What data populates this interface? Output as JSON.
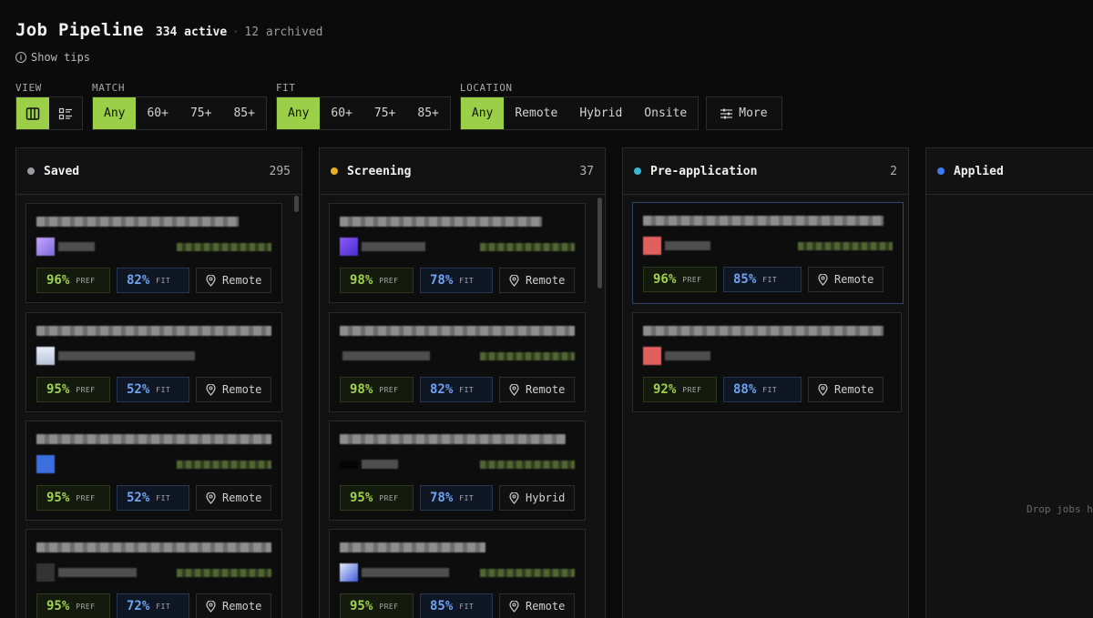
{
  "header": {
    "title": "Job Pipeline",
    "active": "334 active",
    "archived": "12 archived",
    "tips": "Show tips"
  },
  "filters": {
    "view": {
      "label": "VIEW",
      "icons": [
        "board-view-icon",
        "list-view-icon"
      ],
      "selected": "board"
    },
    "match": {
      "label": "MATCH",
      "options": [
        "Any",
        "60+",
        "75+",
        "85+"
      ],
      "selected": "Any"
    },
    "fit": {
      "label": "FIT",
      "options": [
        "Any",
        "60+",
        "75+",
        "85+"
      ],
      "selected": "Any"
    },
    "location": {
      "label": "LOCATION",
      "options": [
        "Any",
        "Remote",
        "Hybrid",
        "Onsite"
      ],
      "selected": "Any"
    },
    "more": "More"
  },
  "columns": [
    {
      "name": "Saved",
      "count": "295",
      "color": "#9a9aa0",
      "cards": [
        {
          "pref": "96%",
          "fit": "82%",
          "loc": "Remote"
        },
        {
          "pref": "95%",
          "fit": "52%",
          "loc": "Remote"
        },
        {
          "pref": "95%",
          "fit": "52%",
          "loc": "Remote"
        },
        {
          "pref": "95%",
          "fit": "72%",
          "loc": "Remote"
        }
      ]
    },
    {
      "name": "Screening",
      "count": "37",
      "color": "#e4b024",
      "cards": [
        {
          "pref": "98%",
          "fit": "78%",
          "loc": "Remote"
        },
        {
          "pref": "98%",
          "fit": "82%",
          "loc": "Remote"
        },
        {
          "pref": "95%",
          "fit": "78%",
          "loc": "Hybrid"
        },
        {
          "pref": "95%",
          "fit": "85%",
          "loc": "Remote"
        }
      ]
    },
    {
      "name": "Pre-application",
      "count": "2",
      "color": "#38b6d6",
      "cards": [
        {
          "pref": "96%",
          "fit": "85%",
          "loc": "Remote"
        },
        {
          "pref": "92%",
          "fit": "88%",
          "loc": "Remote"
        }
      ]
    },
    {
      "name": "Applied",
      "count": "",
      "color": "#3d7bf2",
      "cards": [],
      "empty": "Drop jobs h"
    }
  ],
  "chip_tags": {
    "pref": "PREF",
    "fit": "FIT"
  }
}
